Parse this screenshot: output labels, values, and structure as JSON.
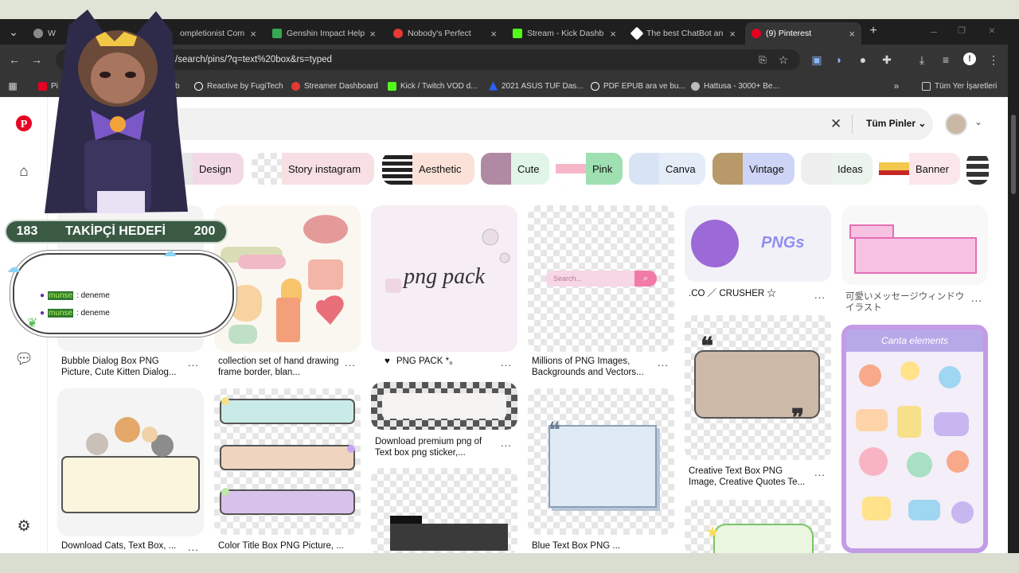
{
  "tabs": [
    {
      "label": "W",
      "fav": "#8a8a8a"
    },
    {
      "label": "ompletionist Com",
      "fav": "#7b8bd6"
    },
    {
      "label": "Genshin Impact Help",
      "fav": "#34a853"
    },
    {
      "label": "Nobody's Perfect",
      "fav": "#e53935"
    },
    {
      "label": "Stream - Kick Dashb",
      "fav": "#53fc18"
    },
    {
      "label": "The best ChatBot an",
      "fav": "#ffffff"
    },
    {
      "label": "(9) Pinterest",
      "fav": "#e60023"
    }
  ],
  "new_tab_icon": "plus-icon",
  "address": {
    "url": "/search/pins/?q=text%20box&rs=typed"
  },
  "bookmarks": [
    {
      "label": "Pi",
      "color": "#e60023"
    },
    {
      "label": "b",
      "color": "#777"
    },
    {
      "label": "Reactive by FugiTech",
      "color": "#ffffff"
    },
    {
      "label": "Streamer Dashboard",
      "color": "#e53935"
    },
    {
      "label": "Kick / Twitch VOD d...",
      "color": "#53fc18"
    },
    {
      "label": "2021 ASUS TUF Das...",
      "color": "#2962ff"
    },
    {
      "label": "PDF EPUB ara ve bu...",
      "color": "#ffffff"
    },
    {
      "label": "Hattusa - 3000+ Be...",
      "color": "#bbbbbb"
    },
    {
      "label": "Tüm Yer İşaretleri",
      "color": "#bbbbbb"
    }
  ],
  "search": {
    "filter_label": "Tüm Pinler"
  },
  "chips": [
    {
      "label": "Design",
      "bg": "#f3d9e6",
      "thumb": "#e6e6e6"
    },
    {
      "label": "Story instagram",
      "bg": "#f7dfe4",
      "thumb": "#cfcfcf"
    },
    {
      "label": "Aesthetic",
      "bg": "#fbe1d8",
      "thumb": "#222"
    },
    {
      "label": "Cute",
      "bg": "#e1f4e8",
      "thumb": "#b08aa3"
    },
    {
      "label": "Pink",
      "bg": "#9fe0b2",
      "thumb": "#f7b6c8"
    },
    {
      "label": "Canva",
      "bg": "#e4ecf8",
      "thumb": "#d8e4f4"
    },
    {
      "label": "Vintage",
      "bg": "#cdd4f5",
      "thumb": "#b89a6a"
    },
    {
      "label": "Ideas",
      "bg": "#eaf3ec",
      "thumb": "#eeeeee"
    },
    {
      "label": "Banner",
      "bg": "#fbe7ea",
      "thumb": "#f2c94c"
    }
  ],
  "pins": [
    {
      "caption": "Bubble Dialog Box PNG Picture, Cute Kitten Dialog..."
    },
    {
      "caption": "collection set of hand drawing frame border, blan..."
    },
    {
      "caption": "PNG PACK *。",
      "art_text": "png pack"
    },
    {
      "caption": "Millions of PNG Images, Backgrounds and Vectors...",
      "search_text": "Search..."
    },
    {
      "caption": ".CO ／ CRUSHER ☆",
      "art_text": "PNGs"
    },
    {
      "caption": "可愛いメッセージウィンドウイラスト"
    },
    {
      "caption": "Download Cats, Text Box, ..."
    },
    {
      "caption": "Color Title Box PNG Picture, ..."
    },
    {
      "caption": "Download premium png of Text box png sticker,..."
    },
    {
      "caption": "Blue Text Box PNG ..."
    },
    {
      "caption": "Creative Text Box PNG Image, Creative Quotes Te..."
    },
    {
      "caption": "",
      "art_text": "Canta elements"
    }
  ],
  "overlay": {
    "goal_current": "183",
    "goal_label": "TAKİPÇİ HEDEFİ",
    "goal_target": "200",
    "chat": [
      {
        "user": "munse",
        "msg": ": deneme"
      },
      {
        "user": "munse",
        "msg": ": deneme"
      }
    ]
  },
  "more_dots": "..."
}
